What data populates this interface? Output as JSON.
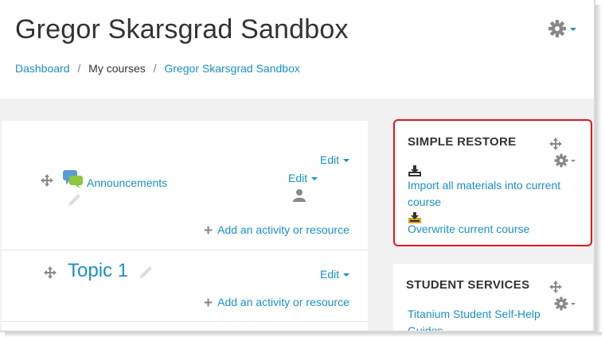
{
  "header": {
    "title": "Gregor Skarsgrad Sandbox",
    "breadcrumb": {
      "dashboard": "Dashboard",
      "my_courses": "My courses",
      "course": "Gregor Skarsgrad Sandbox",
      "separator": "/"
    }
  },
  "main": {
    "section0": {
      "edit_label": "Edit",
      "activity": {
        "name": "Announcements",
        "edit_label": "Edit"
      },
      "add_label": "Add an activity or resource"
    },
    "topic1": {
      "title": "Topic 1",
      "edit_label": "Edit",
      "add_label": "Add an activity or resource"
    }
  },
  "blocks": {
    "simple_restore": {
      "title": "SIMPLE RESTORE",
      "import_label": "Import all materials into current course",
      "overwrite_label": "Overwrite current course",
      "highlight_color": "#e5131c"
    },
    "student_services": {
      "title": "STUDENT SERVICES",
      "link_label": "Titanium Student Self-Help Guides"
    }
  },
  "colors": {
    "link": "#1a8fc9",
    "page_background": "#f1f1f1",
    "icon_grey": "#888888"
  },
  "icons": [
    "gear-icon",
    "move-icon",
    "announcement-icon",
    "pencil-icon",
    "user-icon",
    "plus-icon",
    "download-icon"
  ]
}
